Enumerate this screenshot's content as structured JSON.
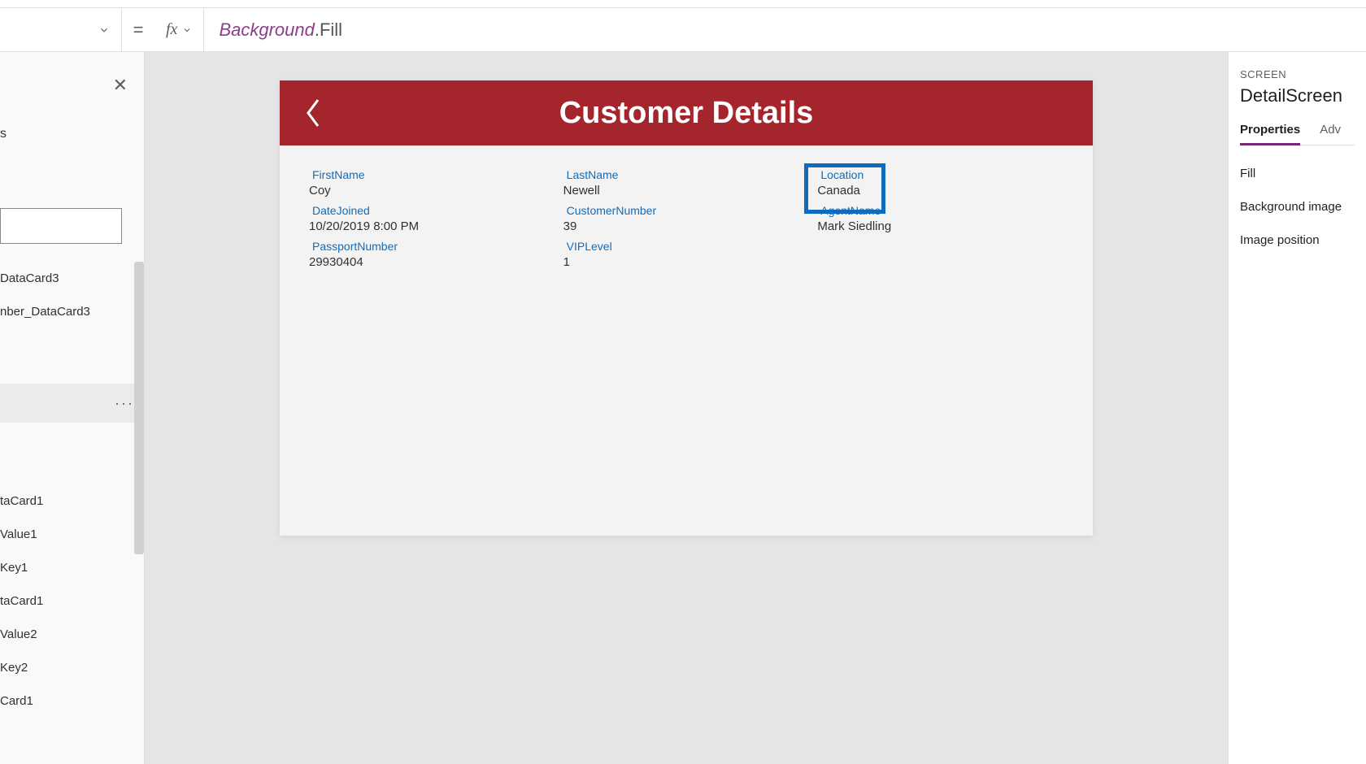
{
  "formula_bar": {
    "equals": "=",
    "fx": "fx",
    "expression_ident": "Background",
    "expression_prop": ".Fill"
  },
  "left_panel": {
    "heading_suffix": "s",
    "items": [
      "DataCard3",
      "nber_DataCard3",
      "",
      "taCard1",
      "Value1",
      "Key1",
      "taCard1",
      "Value2",
      "Key2",
      "Card1"
    ]
  },
  "screen": {
    "header_title": "Customer Details",
    "cards": [
      {
        "label": "FirstName",
        "value": "Coy"
      },
      {
        "label": "LastName",
        "value": "Newell"
      },
      {
        "label": "Location",
        "value": "Canada",
        "selected": true
      },
      {
        "label": "DateJoined",
        "value": "10/20/2019 8:00 PM"
      },
      {
        "label": "CustomerNumber",
        "value": "39"
      },
      {
        "label": "AgentName",
        "value": "Mark Siedling"
      },
      {
        "label": "PassportNumber",
        "value": "29930404"
      },
      {
        "label": "VIPLevel",
        "value": "1"
      }
    ]
  },
  "right_panel": {
    "kicker": "SCREEN",
    "name": "DetailScreen",
    "tabs": [
      "Properties",
      "Adv"
    ],
    "props": [
      "Fill",
      "Background image",
      "Image position"
    ]
  }
}
